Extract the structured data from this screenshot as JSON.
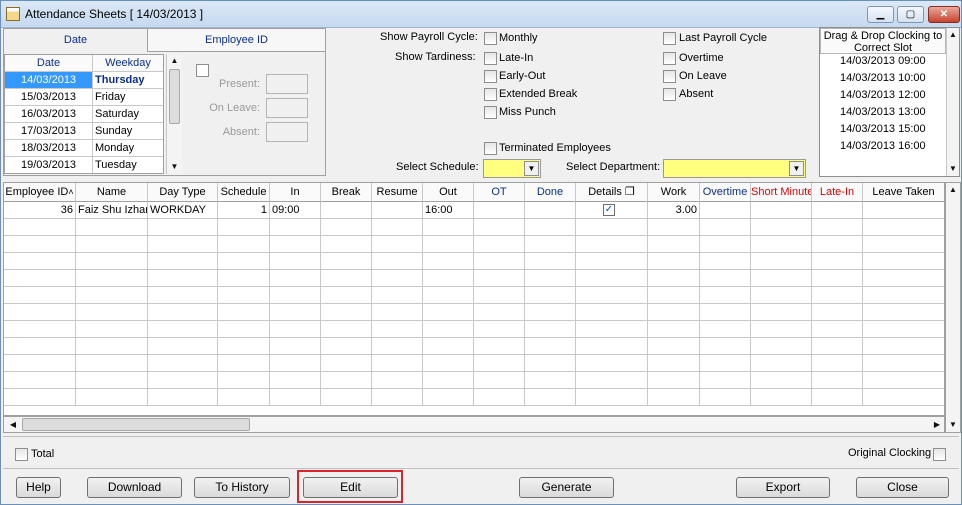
{
  "window": {
    "title": "Attendance Sheets   [ 14/03/2013 ]",
    "minimize": "▁",
    "maximize": "▢",
    "close": "✕"
  },
  "tabs": {
    "date": "Date",
    "employee_id": "Employee ID"
  },
  "date_list": {
    "headers": [
      "Date",
      "Weekday"
    ],
    "rows": [
      {
        "date": "14/03/2013",
        "weekday": "Thursday"
      },
      {
        "date": "15/03/2013",
        "weekday": "Friday"
      },
      {
        "date": "16/03/2013",
        "weekday": "Saturday"
      },
      {
        "date": "17/03/2013",
        "weekday": "Sunday"
      },
      {
        "date": "18/03/2013",
        "weekday": "Monday"
      },
      {
        "date": "19/03/2013",
        "weekday": "Tuesday"
      }
    ]
  },
  "employee_panel": {
    "present_label": "Present:",
    "on_leave_label": "On Leave:",
    "absent_label": "Absent:"
  },
  "filters": {
    "show_payroll_cycle": "Show Payroll Cycle:",
    "show_tardiness": "Show Tardiness:",
    "monthly": "Monthly",
    "last_payroll_cycle": "Last Payroll Cycle",
    "late_in": "Late-In",
    "early_out": "Early-Out",
    "extended_break": "Extended Break",
    "miss_punch": "Miss Punch",
    "overtime": "Overtime",
    "on_leave": "On Leave",
    "absent": "Absent",
    "terminated_employees": "Terminated Employees",
    "select_schedule": "Select Schedule:",
    "select_department": "Select Department:"
  },
  "slots": {
    "header": "Drag & Drop Clocking to Correct Slot",
    "items": [
      "14/03/2013 09:00",
      "14/03/2013 10:00",
      "14/03/2013 12:00",
      "14/03/2013 13:00",
      "14/03/2013 15:00",
      "14/03/2013 16:00"
    ]
  },
  "grid": {
    "columns": [
      "Employee ID",
      "Name",
      "Day Type",
      "Schedule",
      "In",
      "Break",
      "Resume",
      "Out",
      "OT",
      "Done",
      "Details",
      "Work",
      "Overtime",
      "Short Minute",
      "Late-In",
      "Leave Taken"
    ],
    "sort_indicator": "˄",
    "details_icon": "❐",
    "rows": [
      {
        "employee_id": "36",
        "name": "Faiz Shu Izhar",
        "day_type": "WORKDAY",
        "schedule": "1",
        "in": "09:00",
        "out": "16:00",
        "details_checked": true,
        "work": "3.00"
      }
    ]
  },
  "footer": {
    "total_label": "Total",
    "original_clocking_label": "Original Clocking",
    "buttons": {
      "help": "Help",
      "download": "Download",
      "to_history": "To History",
      "edit": "Edit",
      "generate": "Generate",
      "export": "Export",
      "close": "Close"
    }
  },
  "colors": {
    "header_blue": "#0a2f8c",
    "header_red": "#e00000",
    "select_yellow": "#ffff80",
    "selection_blue": "#3399ff",
    "highlight_red": "#d9242a"
  }
}
